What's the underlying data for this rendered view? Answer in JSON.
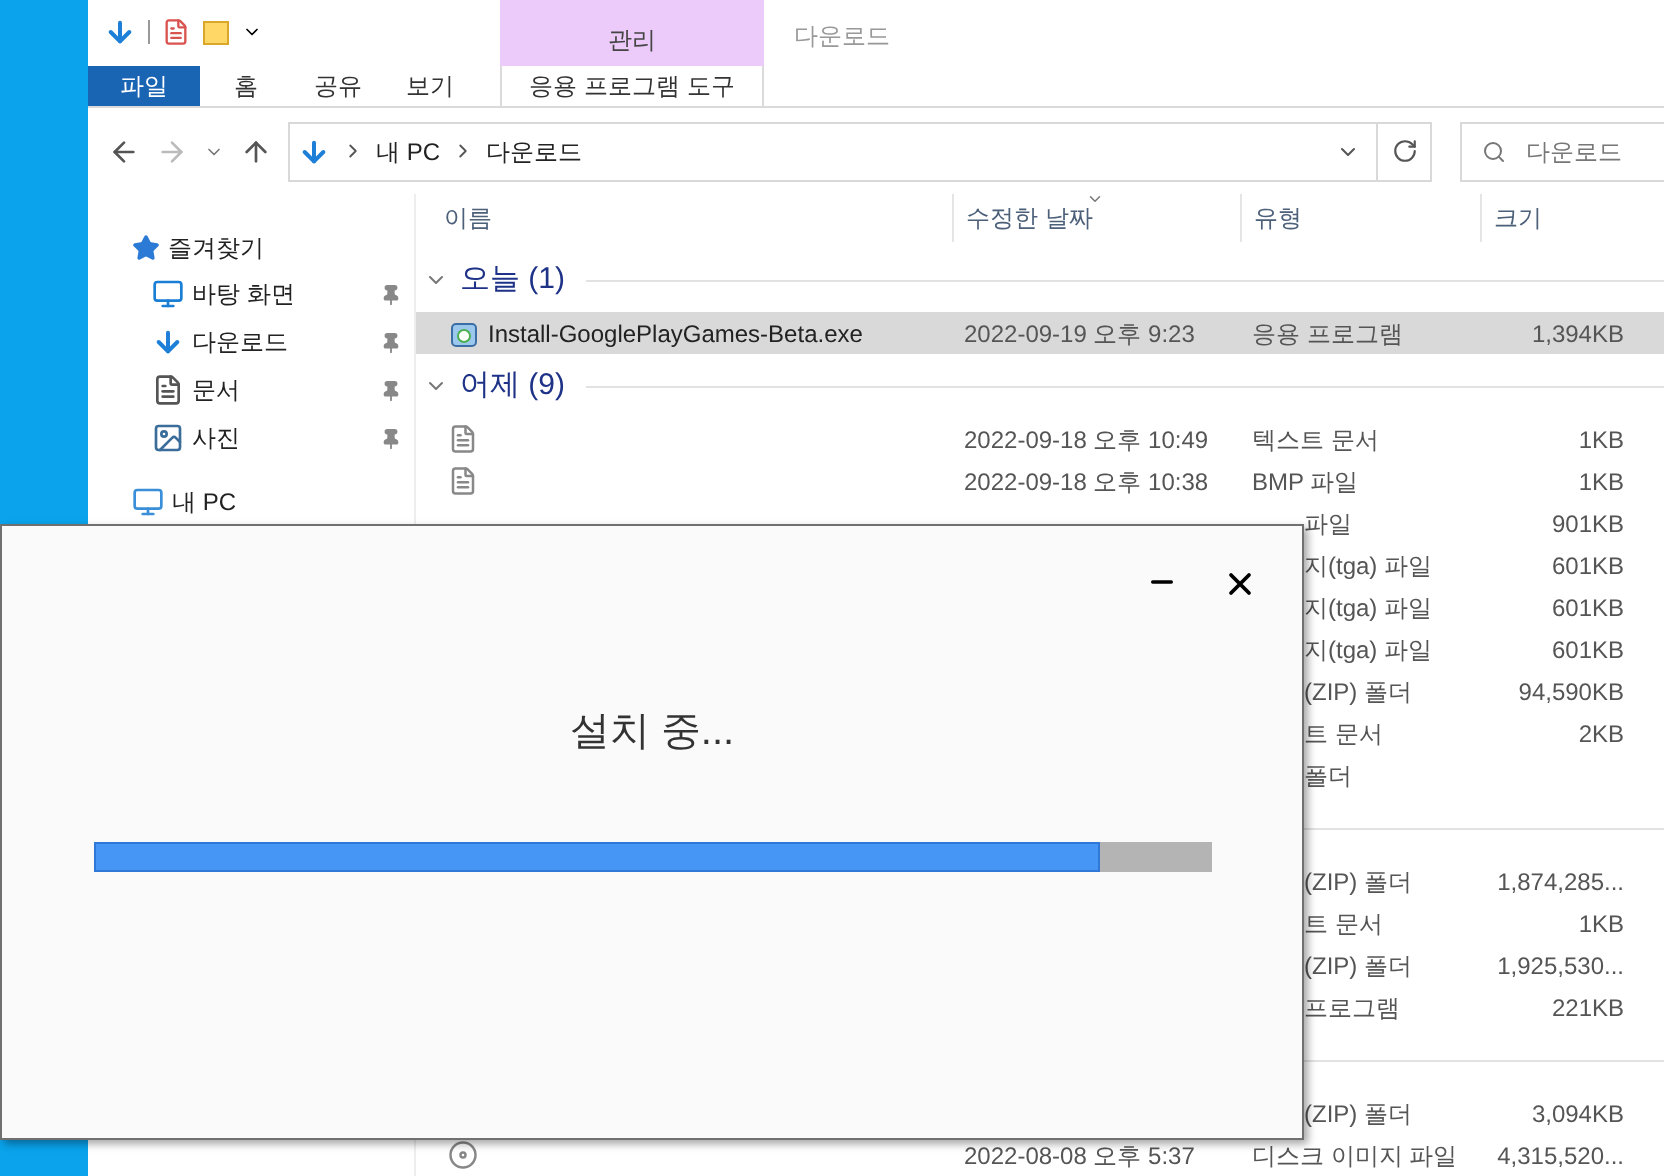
{
  "ribbon": {
    "context_tab": "관리",
    "window_title": "다운로드",
    "context_subtab": "응용 프로그램 도구",
    "tabs": [
      {
        "label": "파일",
        "selected": true
      },
      {
        "label": "홈",
        "selected": false
      },
      {
        "label": "공유",
        "selected": false
      },
      {
        "label": "보기",
        "selected": false
      }
    ]
  },
  "address": {
    "path": [
      "내 PC",
      "다운로드"
    ]
  },
  "search": {
    "placeholder": "다운로드"
  },
  "sidebar": {
    "items": [
      {
        "label": "즐겨찾기",
        "kind": "favorites",
        "children": [
          {
            "label": "바탕 화면",
            "kind": "desktop",
            "pinned": true
          },
          {
            "label": "다운로드",
            "kind": "downloads",
            "pinned": true
          },
          {
            "label": "문서",
            "kind": "documents",
            "pinned": true
          },
          {
            "label": "사진",
            "kind": "pictures",
            "pinned": true
          }
        ]
      },
      {
        "label": "내 PC",
        "kind": "computer"
      }
    ]
  },
  "columns": [
    "이름",
    "수정한 날짜",
    "유형",
    "크기"
  ],
  "groups": [
    {
      "label": "오늘 (1)",
      "rows": [
        {
          "kind": "application",
          "name": "Install-GooglePlayGames-Beta.exe",
          "date": "2022-09-19 오후 9:23",
          "type": "응용 프로그램",
          "size": "1,394KB",
          "selected": true
        }
      ]
    },
    {
      "label": "어제 (9)",
      "rows": [
        {
          "kind": "document",
          "date": "2022-09-18 오후 10:49",
          "type": "텍스트 문서",
          "size": "1KB",
          "selected": false
        },
        {
          "kind": "document",
          "date": "2022-09-18 오후 10:38",
          "type": "BMP 파일",
          "size": "1KB",
          "selected": false
        },
        {
          "kind": "covered",
          "type": "파일",
          "size": "901KB",
          "selected": false
        },
        {
          "kind": "covered",
          "type": "지(tga) 파일",
          "size": "601KB",
          "selected": false
        },
        {
          "kind": "covered",
          "type": "지(tga) 파일",
          "size": "601KB",
          "selected": false
        },
        {
          "kind": "covered",
          "type": "지(tga) 파일",
          "size": "601KB",
          "selected": false
        },
        {
          "kind": "covered",
          "type": "(ZIP) 폴더",
          "size": "94,590KB",
          "selected": false
        },
        {
          "kind": "covered",
          "type": "트 문서",
          "size": "2KB",
          "selected": false
        },
        {
          "kind": "covered",
          "type": "폴더",
          "selected": false
        }
      ]
    },
    {
      "rows": [
        {
          "kind": "covered",
          "type": "(ZIP) 폴더",
          "size": "1,874,285...",
          "selected": false
        },
        {
          "kind": "covered",
          "type": "트 문서",
          "size": "1KB",
          "selected": false
        },
        {
          "kind": "covered",
          "type": "(ZIP) 폴더",
          "size": "1,925,530...",
          "selected": false
        },
        {
          "kind": "covered",
          "type": "프로그램",
          "size": "221KB",
          "selected": false
        }
      ]
    },
    {
      "rows": [
        {
          "kind": "covered",
          "type": "(ZIP) 폴더",
          "size": "3,094KB",
          "selected": false
        },
        {
          "kind": "disc_image",
          "date": "2022-08-08 오후 5:37",
          "type": "디스크 이미지 파일",
          "size": "4,315,520...",
          "selected": false
        }
      ]
    }
  ],
  "dialog": {
    "title": "설치 중...",
    "progress": {
      "level": 0.9
    }
  }
}
